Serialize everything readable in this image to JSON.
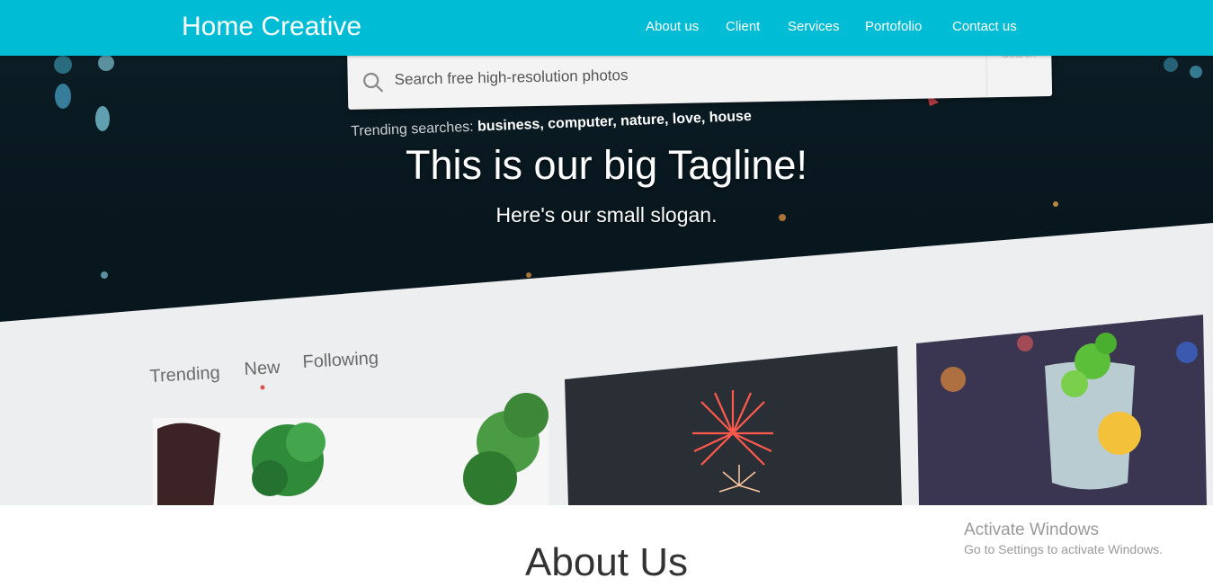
{
  "navbar": {
    "brand": "Home Creative",
    "links": [
      {
        "label": "About us"
      },
      {
        "label": "Client"
      },
      {
        "label": "Services"
      },
      {
        "label": "Portofolio"
      },
      {
        "label": "Contact us"
      }
    ],
    "background_color": "#00bcd4"
  },
  "hero": {
    "tagline": "This is our big Tagline!",
    "slogan": "Here's our small slogan.",
    "background_photo": {
      "search_placeholder": "Search free high-resolution photos",
      "search_button": "Search",
      "trending_label": "Trending searches:",
      "trending_terms": "business, computer, nature, love, house",
      "tabs": [
        "Trending",
        "New",
        "Following"
      ]
    }
  },
  "about": {
    "title": "About Us"
  },
  "watermark": {
    "title": "Activate Windows",
    "subtitle": "Go to Settings to activate Windows."
  }
}
